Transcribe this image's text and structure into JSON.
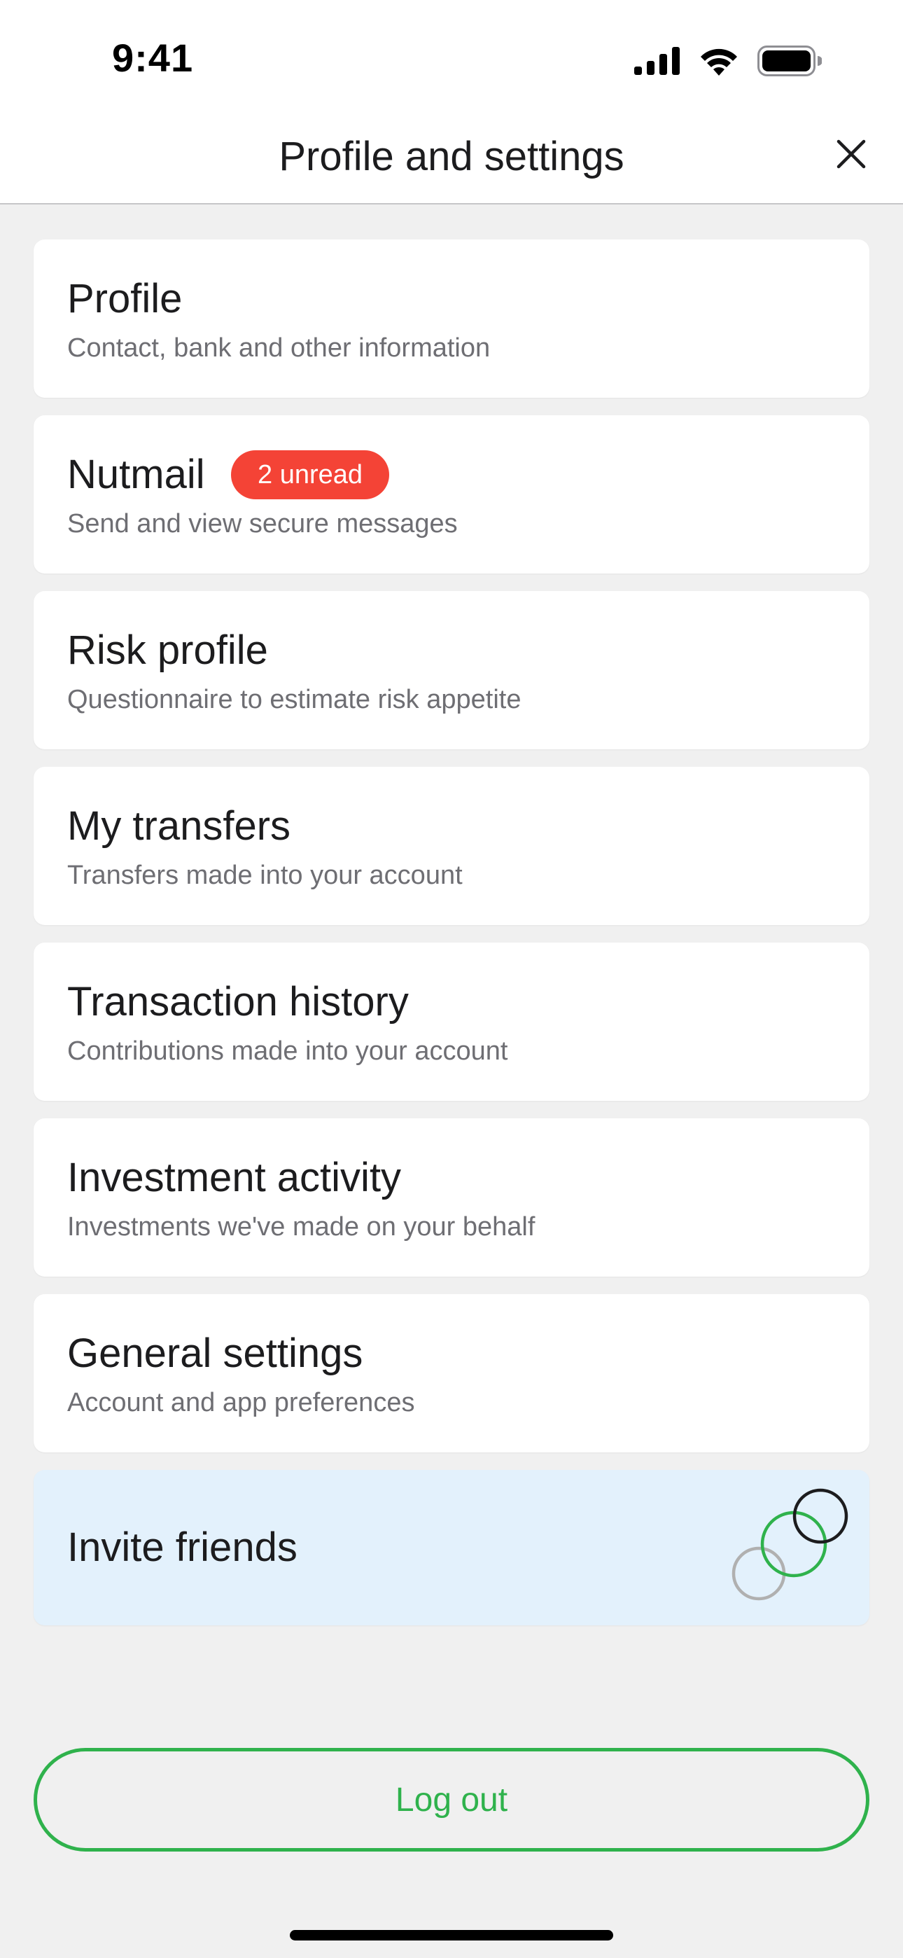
{
  "status_bar": {
    "time": "9:41",
    "icons": [
      "cellular-signal-icon",
      "wifi-icon",
      "battery-icon"
    ]
  },
  "header": {
    "title": "Profile and settings",
    "close_icon": "close-icon"
  },
  "menu": [
    {
      "title": "Profile",
      "subtitle": "Contact, bank and other information"
    },
    {
      "title": "Nutmail",
      "subtitle": "Send and view secure messages",
      "badge": "2 unread"
    },
    {
      "title": "Risk profile",
      "subtitle": "Questionnaire to estimate risk appetite"
    },
    {
      "title": "My transfers",
      "subtitle": "Transfers made into your account"
    },
    {
      "title": "Transaction history",
      "subtitle": "Contributions made into your account"
    },
    {
      "title": "Investment activity",
      "subtitle": "Investments we've made on your behalf"
    },
    {
      "title": "General settings",
      "subtitle": "Account and app preferences"
    }
  ],
  "invite": {
    "title": "Invite friends",
    "icon": "overlapping-circles-icon"
  },
  "logout": {
    "label": "Log out"
  },
  "colors": {
    "accent_green": "#2fb24c",
    "badge_red": "#f44336",
    "invite_bg": "#e3f1fc",
    "page_bg": "#f0f0f0"
  }
}
